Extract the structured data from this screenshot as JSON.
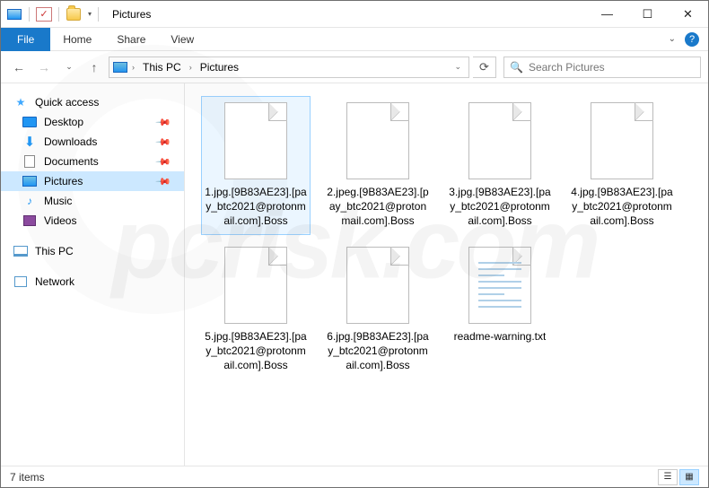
{
  "window": {
    "title": "Pictures"
  },
  "ribbon": {
    "file": "File",
    "tabs": [
      "Home",
      "Share",
      "View"
    ]
  },
  "address": {
    "segments": [
      "This PC",
      "Pictures"
    ]
  },
  "search": {
    "placeholder": "Search Pictures"
  },
  "sidebar": {
    "quick_access": "Quick access",
    "items": [
      {
        "label": "Desktop",
        "pinned": true
      },
      {
        "label": "Downloads",
        "pinned": true
      },
      {
        "label": "Documents",
        "pinned": true
      },
      {
        "label": "Pictures",
        "pinned": true,
        "selected": true
      },
      {
        "label": "Music",
        "pinned": false
      },
      {
        "label": "Videos",
        "pinned": false
      }
    ],
    "this_pc": "This PC",
    "network": "Network"
  },
  "files": [
    {
      "name": "1.jpg.[9B83AE23].[pay_btc2021@protonmail.com].Boss",
      "type": "file",
      "selected": true
    },
    {
      "name": "2.jpeg.[9B83AE23].[pay_btc2021@protonmail.com].Boss",
      "type": "file"
    },
    {
      "name": "3.jpg.[9B83AE23].[pay_btc2021@protonmail.com].Boss",
      "type": "file"
    },
    {
      "name": "4.jpg.[9B83AE23].[pay_btc2021@protonmail.com].Boss",
      "type": "file"
    },
    {
      "name": "5.jpg.[9B83AE23].[pay_btc2021@protonmail.com].Boss",
      "type": "file"
    },
    {
      "name": "6.jpg.[9B83AE23].[pay_btc2021@protonmail.com].Boss",
      "type": "file"
    },
    {
      "name": "readme-warning.txt",
      "type": "txt"
    }
  ],
  "status": {
    "count": "7 items"
  },
  "watermark": "pcrisk.com"
}
